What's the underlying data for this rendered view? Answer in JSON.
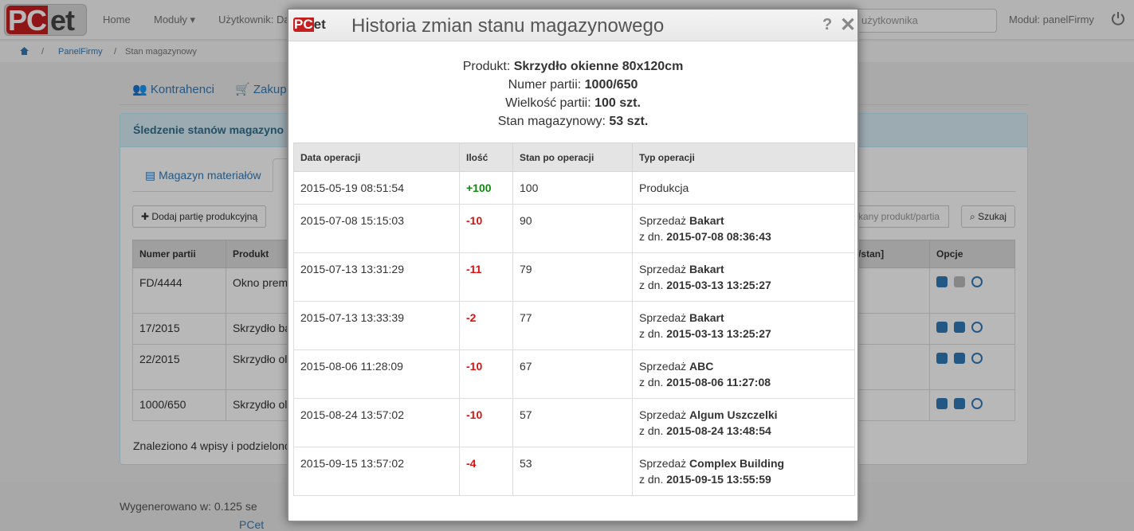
{
  "background": {
    "nav": {
      "home": "Home",
      "modules": "Moduły",
      "user": "Użytkownik: Da",
      "search_placeholder": "użytkownika",
      "module_label": "Moduł: panelFirmy"
    },
    "breadcrumb": {
      "panel": "PanelFirmy",
      "current": "Stan magazynowy"
    },
    "tabs": {
      "contractors": "Kontrahenci",
      "purchase": "Zakup m"
    },
    "panel_title": "Śledzenie stanów magazyno",
    "inner_tabs": {
      "materials": "Magazyn materiałów"
    },
    "add_batch_button": "Dodaj partię produkcyjną",
    "search_input_placeholder": "kany produkt/partia",
    "search_button": "Szukaj",
    "table": {
      "headers": [
        "Numer partii",
        "Produkt",
        "/stan]",
        "Opcje"
      ],
      "rows": [
        {
          "batch": "FD/4444",
          "product": "Okno prem"
        },
        {
          "batch": "17/2015",
          "product": "Skrzydło ba"
        },
        {
          "batch": "22/2015",
          "product": "Skrzydło ol"
        },
        {
          "batch": "1000/650",
          "product": "Skrzydło ol"
        }
      ]
    },
    "found_text": "Znaleziono 4 wpisy i podzielono",
    "footer": {
      "brand": "PCet",
      "generated": "Wygenerowano w: 0.125 se"
    }
  },
  "modal": {
    "logo": {
      "pc": "PC",
      "et": "et"
    },
    "title": "Historia zmian stanu magazynowego",
    "help_label": "?",
    "close_label": "✕",
    "info": {
      "product_label": "Produkt:",
      "product_value": "Skrzydło okienne 80x120cm",
      "batch_label": "Numer partii:",
      "batch_value": "1000/650",
      "size_label": "Wielkość partii:",
      "size_value": "100 szt.",
      "stock_label": "Stan magazynowy:",
      "stock_value": "53 szt."
    },
    "table": {
      "headers": [
        "Data operacji",
        "Ilość",
        "Stan po operacji",
        "Typ operacji"
      ],
      "rows": [
        {
          "date": "2015-05-19 08:51:54",
          "qty": "+100",
          "after": "100",
          "type": "Produkcja",
          "client": "",
          "since_label": "",
          "since": ""
        },
        {
          "date": "2015-07-08 15:15:03",
          "qty": "-10",
          "after": "90",
          "type": "Sprzedaż",
          "client": "Bakart",
          "since_label": "z dn.",
          "since": "2015-07-08 08:36:43"
        },
        {
          "date": "2015-07-13 13:31:29",
          "qty": "-11",
          "after": "79",
          "type": "Sprzedaż",
          "client": "Bakart",
          "since_label": "z dn.",
          "since": "2015-03-13 13:25:27"
        },
        {
          "date": "2015-07-13 13:33:39",
          "qty": "-2",
          "after": "77",
          "type": "Sprzedaż",
          "client": "Bakart",
          "since_label": "z dn.",
          "since": "2015-03-13 13:25:27"
        },
        {
          "date": "2015-08-06 11:28:09",
          "qty": "-10",
          "after": "67",
          "type": "Sprzedaż",
          "client": "ABC",
          "since_label": "z dn.",
          "since": "2015-08-06 11:27:08"
        },
        {
          "date": "2015-08-24 13:57:02",
          "qty": "-10",
          "after": "57",
          "type": "Sprzedaż",
          "client": "Algum Uszczelki",
          "since_label": "z dn.",
          "since": "2015-08-24 13:48:54"
        },
        {
          "date": "2015-09-15 13:57:02",
          "qty": "-4",
          "after": "53",
          "type": "Sprzedaż",
          "client": "Complex Building",
          "since_label": "z dn.",
          "since": "2015-09-15 13:55:59"
        }
      ]
    }
  },
  "colors": {
    "positive": "#118811",
    "negative": "#dd1111",
    "brand_red": "#c51f1f",
    "link": "#337ab7"
  }
}
